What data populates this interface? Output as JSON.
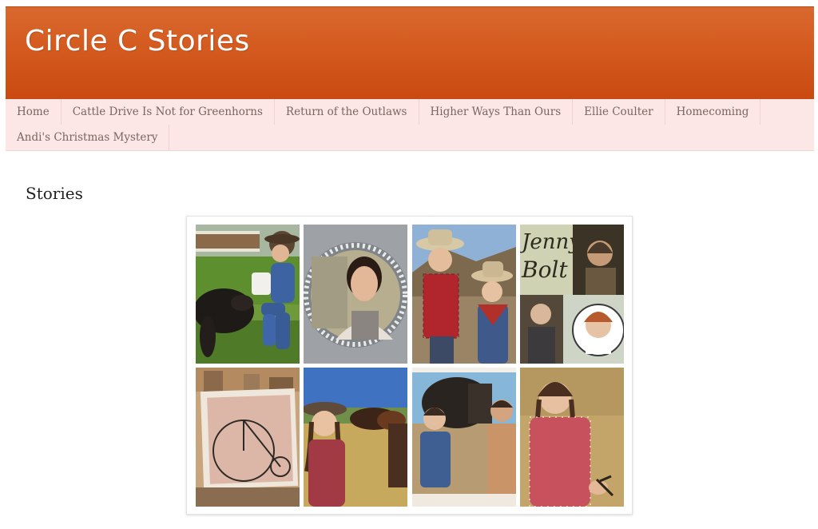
{
  "header": {
    "site_title": "Circle C Stories"
  },
  "nav": {
    "items": [
      "Home",
      "Cattle Drive Is Not for Greenhorns",
      "Return of the Outlaws",
      "Higher Ways Than Ours",
      "Ellie Coulter",
      "Homecoming",
      "Andi's Christmas Mystery"
    ]
  },
  "main": {
    "heading": "Stories"
  },
  "collage": {
    "tile_labels": [
      "Jenny",
      "Bolt"
    ]
  },
  "colors": {
    "header_orange": "#d45a1f",
    "nav_pink": "#fde6e6",
    "nav_text": "#7a6560"
  }
}
